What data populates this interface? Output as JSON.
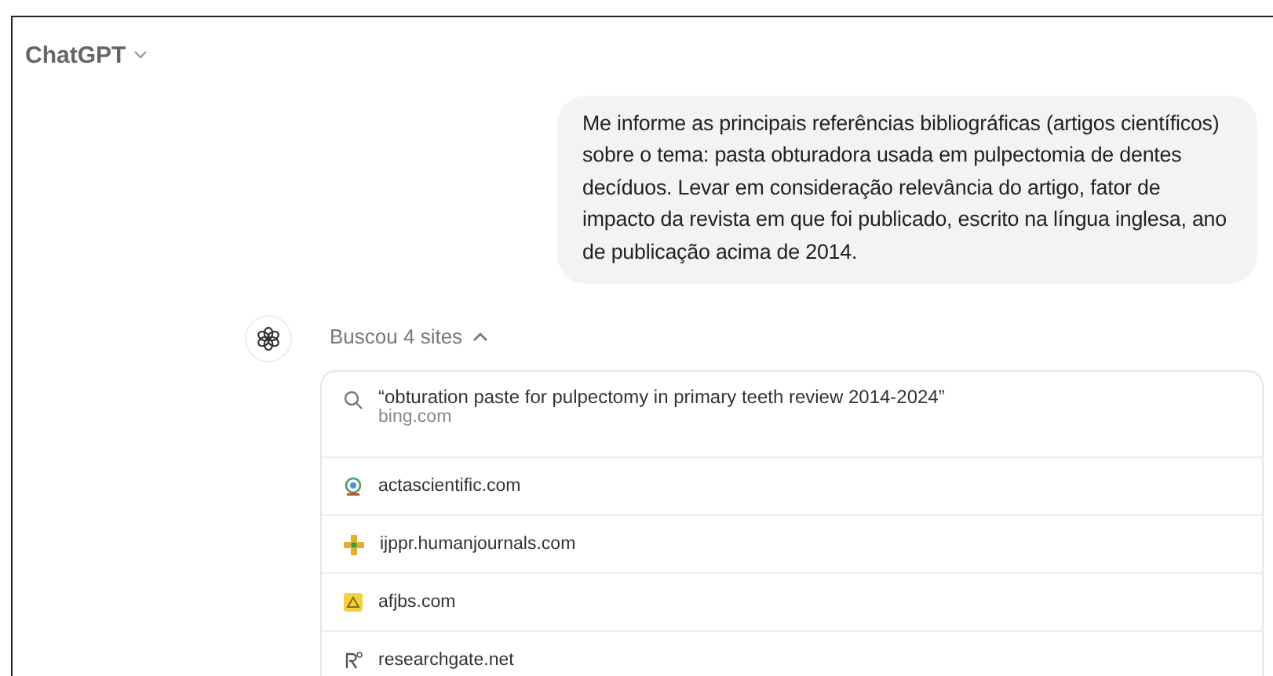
{
  "header": {
    "title": "ChatGPT"
  },
  "user_message": "Me informe as principais referências bibliográficas (artigos científicos) sobre o tema: pasta obturadora usada em pulpectomia de dentes decíduos. Levar em consideração relevância do artigo, fator de impacto da revista em que foi publicado, escrito na língua inglesa, ano de publicação acima de 2014.",
  "search_summary": {
    "label": "Buscou 4 sites",
    "expanded": true
  },
  "sources": [
    {
      "kind": "search",
      "query": "“obturation paste for pulpectomy in primary teeth review 2014-2024”",
      "domain": "bing.com"
    },
    {
      "kind": "site",
      "domain": "actascientific.com"
    },
    {
      "kind": "site",
      "domain": "ijppr.humanjournals.com"
    },
    {
      "kind": "site",
      "domain": "afjbs.com"
    },
    {
      "kind": "site",
      "domain": "researchgate.net"
    }
  ]
}
